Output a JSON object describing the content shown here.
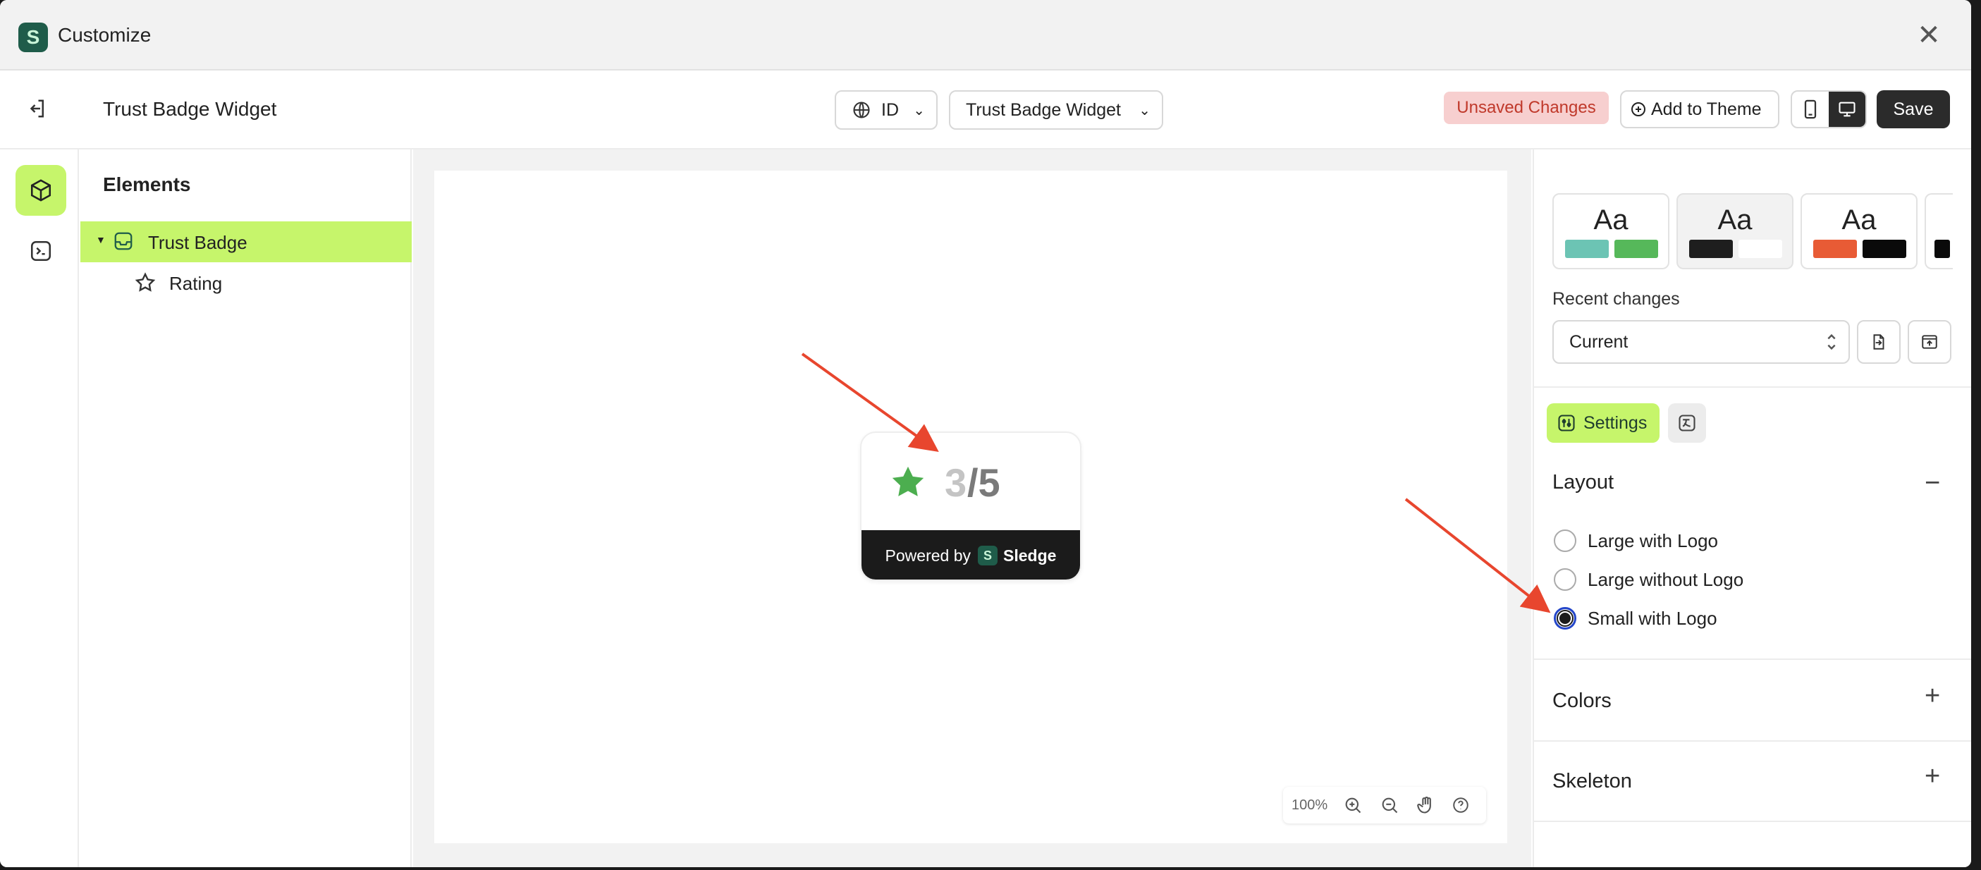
{
  "window": {
    "title": "Customize"
  },
  "toolbar": {
    "page_title": "Trust Badge Widget",
    "language": "ID",
    "widget_select": "Trust Badge Widget",
    "status": "Unsaved Changes",
    "add_to_theme": "Add to Theme",
    "save": "Save"
  },
  "elements_panel": {
    "title": "Elements",
    "tree": [
      {
        "label": "Trust Badge",
        "selected": true
      },
      {
        "label": "Rating",
        "selected": false
      }
    ]
  },
  "canvas": {
    "badge": {
      "rating_value": "3",
      "rating_max": "/5",
      "footer_prefix": "Powered by",
      "brand": "Sledge"
    },
    "zoom_level": "100%"
  },
  "right_panel": {
    "presets": [
      {
        "label": "Aa",
        "colors": [
          "#6cc4b4",
          "#56b85a"
        ]
      },
      {
        "label": "Aa",
        "colors": [
          "#1e1e1e",
          "#ffffff"
        ]
      },
      {
        "label": "Aa",
        "colors": [
          "#e85b35",
          "#0a0a0a"
        ]
      }
    ],
    "recent_changes_label": "Recent changes",
    "recent_changes_value": "Current",
    "tabs": {
      "settings": "Settings"
    },
    "layout": {
      "title": "Layout",
      "options": [
        {
          "label": "Large with Logo",
          "selected": false
        },
        {
          "label": "Large without Logo",
          "selected": false
        },
        {
          "label": "Small with Logo",
          "selected": true
        }
      ]
    },
    "colors_section": "Colors",
    "skeleton_section": "Skeleton"
  },
  "theme": {
    "accent": "#c6f56b",
    "star": "#4cae4f",
    "annotation_arrow": "#e8462e",
    "dark": "#2b2b2b"
  }
}
